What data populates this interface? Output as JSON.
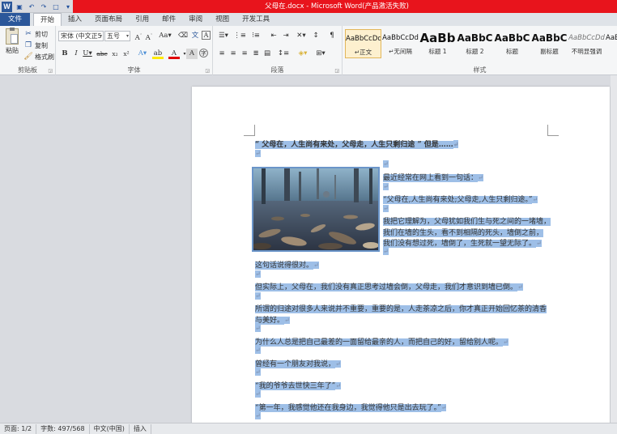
{
  "window": {
    "title": "父母在.docx - Microsoft Word(产品激活失败)",
    "logo": "W"
  },
  "tabs": [
    "文件",
    "开始",
    "插入",
    "页面布局",
    "引用",
    "邮件",
    "审阅",
    "视图",
    "开发工具"
  ],
  "clipboard": {
    "paste": "粘贴",
    "cut": "剪切",
    "copy": "复制",
    "format_painter": "格式刷",
    "label": "剪贴板"
  },
  "font": {
    "name": "宋体 (中文正5",
    "size": "五号",
    "label": "字体"
  },
  "paragraph": {
    "label": "段落"
  },
  "styles": {
    "label": "样式",
    "items": [
      {
        "sample": "AaBbCcDd",
        "name": "↵正文",
        "active": true
      },
      {
        "sample": "AaBbCcDd",
        "name": "↵无间隔",
        "active": false
      },
      {
        "sample": "AaBb",
        "name": "标题 1",
        "active": false
      },
      {
        "sample": "AaBbC",
        "name": "标题 2",
        "active": false
      },
      {
        "sample": "AaBbC",
        "name": "标题",
        "active": false
      },
      {
        "sample": "AaBbC",
        "name": "副标题",
        "active": false
      },
      {
        "sample": "AaBbCcDd",
        "name": "不明显强调",
        "active": false
      },
      {
        "sample": "AaBb",
        "name": "",
        "active": false
      }
    ]
  },
  "document": {
    "heading": "“ 父母在，人生尚有来处，父母走，人生只剩归途 ” 但是……",
    "lines_right": [
      "最近经常在网上看到一句话：",
      "“父母在,人生尚有来处;父母走,人生只剩归途。”",
      "我把它理解为，父母犹如我们生与死之间的一堵墙，",
      "我们在墙的生头，看不到相隔的死头，墙倒之前，",
      "我们没有想过死，墙倒了，生死就一望无际了。"
    ],
    "lines_full": [
      "这句话说得很对。",
      "但实际上，父母在，我们没有真正思考过墙会倒，父母走，我们才意识到墙已倒。",
      "所谓的归途对很多人来说并不重要，重要的是，人走茶凉之后，你才真正开始回忆茶的清香",
      "与美好。",
      "为什么人总是把自己最差的一面留给最亲的人，而把自己的好，留给别人呢。",
      "曾经有一个朋友对我说，",
      "“我的爷爷去世快三年了”",
      "“第一年，我感觉他还在我身边，我觉得他只是出去玩了。”"
    ]
  },
  "status": {
    "page": "页面: 1/2",
    "words": "字数: 497/568",
    "lang": "中文(中国)",
    "mode": "插入"
  },
  "colors": {
    "accent": "#2b579a",
    "title_bar": "#e8141c",
    "selection": "#9ebfe7"
  }
}
